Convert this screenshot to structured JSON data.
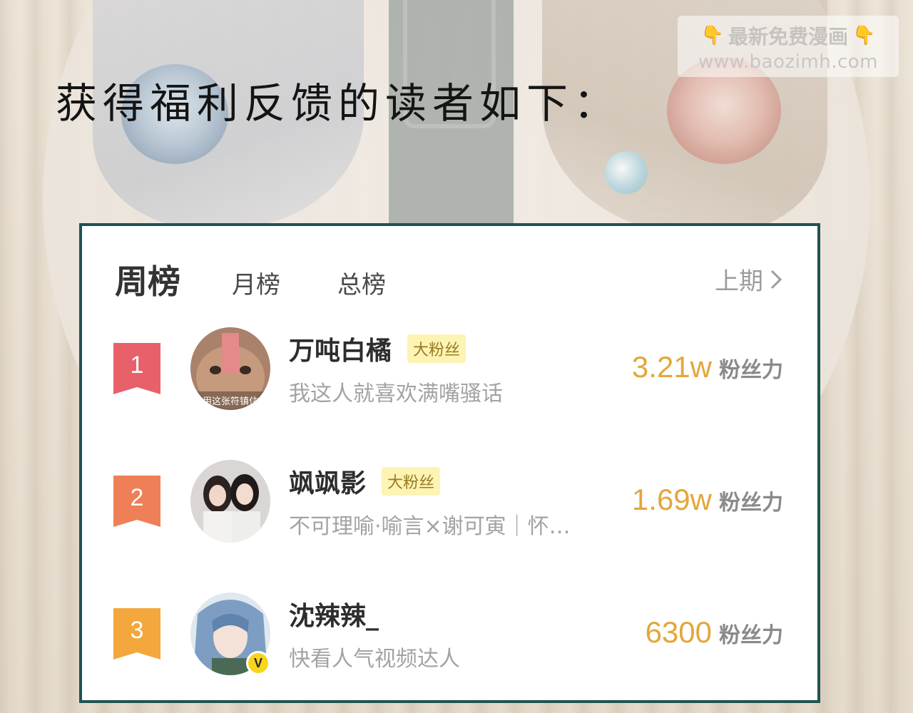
{
  "headline": "获得福利反馈的读者如下：",
  "watermark": {
    "line1": "最新免费漫画",
    "line2": "www.baozimh.com"
  },
  "leaderboard": {
    "tabs": [
      {
        "label": "周榜",
        "active": true
      },
      {
        "label": "月榜",
        "active": false
      },
      {
        "label": "总榜",
        "active": false
      }
    ],
    "prev_period_label": "上期",
    "rows": [
      {
        "rank": "1",
        "name": "万吨白橘",
        "tag": "大粉丝",
        "signature": "我这人就喜欢满嘴骚话",
        "avatar_caption": "用这张符镇住",
        "fan_power": "3.21w",
        "fan_power_unit": "粉丝力",
        "badge_color": "#e8616a"
      },
      {
        "rank": "2",
        "name": "飒飒影",
        "tag": "大粉丝",
        "signature": "不可理喻·喻言×谢可寅｜怀…",
        "fan_power": "1.69w",
        "fan_power_unit": "粉丝力",
        "badge_color": "#ee7f56"
      },
      {
        "rank": "3",
        "name": "沈辣辣_",
        "tag": "",
        "signature": "快看人气视频达人",
        "verified_badge": "V",
        "fan_power": "6300",
        "fan_power_unit": "粉丝力",
        "badge_color": "#f3a73c"
      }
    ]
  },
  "colors": {
    "card_border": "#1f5350",
    "fan_power": "#e4a63a",
    "tag_bg": "#fdf3b3"
  }
}
